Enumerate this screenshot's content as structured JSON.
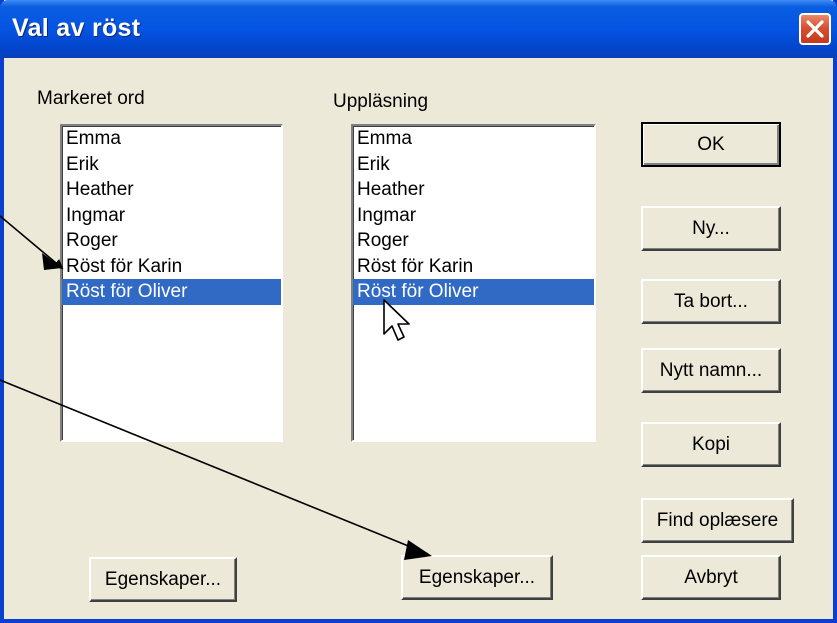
{
  "window": {
    "title": "Val av röst",
    "close_label": "×"
  },
  "left_group": {
    "label": "Markeret ord",
    "items": [
      "Emma",
      "Erik",
      "Heather",
      "Ingmar",
      "Roger",
      "Röst för Karin",
      "Röst för Oliver"
    ],
    "selected_index": 6,
    "properties_label": "Egenskaper..."
  },
  "right_group": {
    "label": "Uppläsning",
    "items": [
      "Emma",
      "Erik",
      "Heather",
      "Ingmar",
      "Roger",
      "Röst för Karin",
      "Röst för Oliver"
    ],
    "selected_index": 6,
    "properties_label": "Egenskaper..."
  },
  "buttons": {
    "ok": "OK",
    "new": "Ny...",
    "remove": "Ta bort...",
    "rename": "Nytt namn...",
    "copy": "Kopi",
    "find_readers": "Find oplæsere",
    "cancel": "Avbryt"
  },
  "colors": {
    "title_bar": "#0554e3",
    "selection": "#316ac5",
    "dialog_face": "#ece9d8",
    "close_button": "#d65133"
  }
}
